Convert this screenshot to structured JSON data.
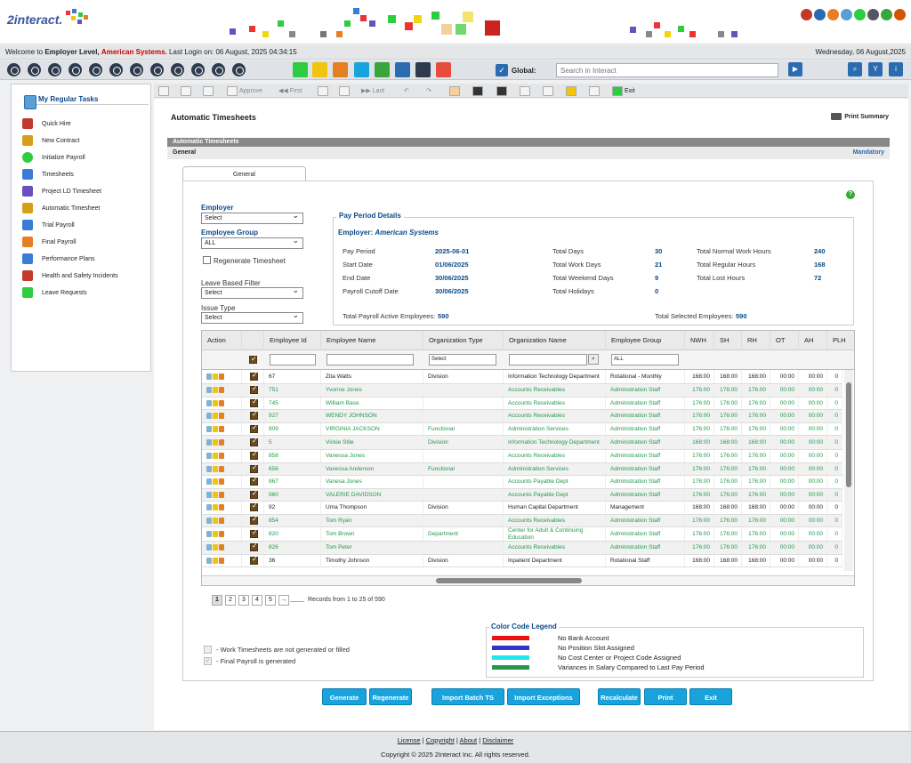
{
  "app": {
    "logo_text": "2interact."
  },
  "welcome": {
    "prefix": "Welcome to",
    "level": "Employer Level,",
    "company": "American Systems.",
    "login": "Last Login on: 06 August, 2025 04:34:15",
    "date": "Wednesday, 06 August,2025"
  },
  "global_search": {
    "label": "Global:",
    "placeholder": "Search in Interact"
  },
  "sidebar": {
    "title": "My Regular Tasks",
    "items": [
      {
        "label": "Quick Hire",
        "icon": "quick-hire-icon",
        "color": "#c0392b"
      },
      {
        "label": "New Contract",
        "icon": "new-contract-icon",
        "color": "#d4a017"
      },
      {
        "label": "Initialize Payroll",
        "icon": "initialize-payroll-icon",
        "color": "#2ecc40"
      },
      {
        "label": "Timesheets",
        "icon": "timesheets-icon",
        "color": "#3a7bd5"
      },
      {
        "label": "Project LD Timesheet",
        "icon": "project-timesheet-icon",
        "color": "#6b4fbb"
      },
      {
        "label": "Automatic Timesheet",
        "icon": "automatic-timesheet-icon",
        "color": "#d4a017"
      },
      {
        "label": "Trial Payroll",
        "icon": "trial-payroll-icon",
        "color": "#3a7bd5"
      },
      {
        "label": "Final Payroll",
        "icon": "final-payroll-icon",
        "color": "#e67e22"
      },
      {
        "label": "Performance Plans",
        "icon": "performance-plans-icon",
        "color": "#3a7bd5"
      },
      {
        "label": "Health and Safety Incidents",
        "icon": "health-safety-icon",
        "color": "#c0392b"
      },
      {
        "label": "Leave Requests",
        "icon": "leave-requests-icon",
        "color": "#2ecc40"
      }
    ]
  },
  "actionbar": {
    "approve": "Approve",
    "first": "First",
    "last": "Last",
    "exit": "Exit"
  },
  "page": {
    "title": "Automatic Timesheets",
    "print": "Print Summary",
    "section": "Automatic Timesheets",
    "subsection": "General",
    "mandatory": "Mandatory",
    "tab": "General"
  },
  "form": {
    "employer_label": "Employer",
    "employer_value": "Select",
    "group_label": "Employee Group",
    "group_value": "ALL",
    "regenerate_label": "Regenerate Timesheet",
    "leave_label": "Leave Based Filter",
    "leave_value": "Select",
    "issue_label": "Issue Type",
    "issue_value": "Select"
  },
  "pay_period": {
    "title": "Pay Period Details",
    "employer_label": "Employer:",
    "employer_name": "American Systems",
    "pay_period_label": "Pay Period",
    "pay_period": "2025-06-01",
    "start_label": "Start Date",
    "start": "01/06/2025",
    "end_label": "End Date",
    "end": "30/06/2025",
    "cutoff_label": "Payroll Cutoff Date",
    "cutoff": "30/06/2025",
    "total_days_label": "Total Days",
    "total_days": "30",
    "work_days_label": "Total Work Days",
    "work_days": "21",
    "weekend_label": "Total Weekend Days",
    "weekend": "9",
    "holidays_label": "Total Holidays",
    "holidays": "0",
    "normal_hours_label": "Total Normal Work Hours",
    "normal_hours": "240",
    "regular_hours_label": "Total Regular Hours",
    "regular_hours": "168",
    "lost_hours_label": "Total Lost Hours",
    "lost_hours": "72",
    "active_label": "Total Payroll Active Employees:",
    "active": "590",
    "selected_label": "Total Selected Employees:",
    "selected": "590"
  },
  "grid": {
    "columns": [
      "Action",
      "Employee Id",
      "Employee Name",
      "Organization Type",
      "Organization Name",
      "Employee Group",
      "NWH",
      "SH",
      "RH",
      "OT",
      "AH",
      "PLH"
    ],
    "filters": {
      "org_type": "Select",
      "group": "ALL"
    },
    "rows": [
      {
        "id": "67",
        "name": "Zita Watts",
        "otype": "Division",
        "oname": "Information Technology Department",
        "group": "Rotational - Monthly",
        "nwh": "168:00",
        "sh": "168:00",
        "rh": "168:00",
        "ot": "00:00",
        "ah": "00:00",
        "green": false
      },
      {
        "id": "751",
        "name": "Yvonne Jones",
        "otype": "",
        "oname": "Accounts Receivables",
        "group": "Administration Staff",
        "nwh": "176:00",
        "sh": "176:00",
        "rh": "176:00",
        "ot": "00:00",
        "ah": "00:00",
        "green": true
      },
      {
        "id": "745",
        "name": "William Base",
        "otype": "",
        "oname": "Accounts Receivables",
        "group": "Administration Staff",
        "nwh": "176:00",
        "sh": "176:00",
        "rh": "176:00",
        "ot": "00:00",
        "ah": "00:00",
        "green": true
      },
      {
        "id": "927",
        "name": "WENDY JOHNSON",
        "otype": "",
        "oname": "Accounts Receivables",
        "group": "Administration Staff",
        "nwh": "176:00",
        "sh": "176:00",
        "rh": "176:00",
        "ot": "00:00",
        "ah": "00:00",
        "green": true
      },
      {
        "id": "909",
        "name": "VIRGINIA JACKSON",
        "otype": "Functional",
        "oname": "Administration Services",
        "group": "Administration Staff",
        "nwh": "176:00",
        "sh": "176:00",
        "rh": "176:00",
        "ot": "00:00",
        "ah": "00:00",
        "green": true
      },
      {
        "id": "5",
        "name": "Vickie Stile",
        "otype": "Division",
        "oname": "Information Technology Department",
        "group": "Administration Staff",
        "nwh": "168:00",
        "sh": "168:00",
        "rh": "168:00",
        "ot": "00:00",
        "ah": "00:00",
        "green": true
      },
      {
        "id": "858",
        "name": "Vanessa Jones",
        "otype": "",
        "oname": "Accounts Receivables",
        "group": "Administration Staff",
        "nwh": "176:00",
        "sh": "176:00",
        "rh": "176:00",
        "ot": "00:00",
        "ah": "00:00",
        "green": true
      },
      {
        "id": "656",
        "name": "Vanessa Anderson",
        "otype": "Functional",
        "oname": "Administration Services",
        "group": "Administration Staff",
        "nwh": "176:00",
        "sh": "176:00",
        "rh": "176:00",
        "ot": "00:00",
        "ah": "00:00",
        "green": true
      },
      {
        "id": "867",
        "name": "Vanesa Jones",
        "otype": "",
        "oname": "Accounts Payable Dept",
        "group": "Administration Staff",
        "nwh": "176:00",
        "sh": "176:00",
        "rh": "176:00",
        "ot": "00:00",
        "ah": "00:00",
        "green": true
      },
      {
        "id": "960",
        "name": "VALERIE DAVIDSON",
        "otype": "",
        "oname": "Accounts Payable Dept",
        "group": "Administration Staff",
        "nwh": "176:00",
        "sh": "176:00",
        "rh": "176:00",
        "ot": "00:00",
        "ah": "00:00",
        "green": true
      },
      {
        "id": "92",
        "name": "Uma Thompson",
        "otype": "Division",
        "oname": "Human Capital Department",
        "group": "Management",
        "nwh": "168:00",
        "sh": "168:00",
        "rh": "168:00",
        "ot": "00:00",
        "ah": "00:00",
        "green": false
      },
      {
        "id": "854",
        "name": "Tom Ryan",
        "otype": "",
        "oname": "Accounts Receivables",
        "group": "Administration Staff",
        "nwh": "176:00",
        "sh": "176:00",
        "rh": "176:00",
        "ot": "00:00",
        "ah": "00:00",
        "green": true
      },
      {
        "id": "820",
        "name": "Tom Brown",
        "otype": "Department",
        "oname": "Center for Adult & Continuing Education",
        "group": "Administration Staff",
        "nwh": "176:00",
        "sh": "176:00",
        "rh": "176:00",
        "ot": "00:00",
        "ah": "00:00",
        "green": true
      },
      {
        "id": "826",
        "name": "Tom Peter",
        "otype": "",
        "oname": "Accounts Receivables",
        "group": "Administration Staff",
        "nwh": "176:00",
        "sh": "176:00",
        "rh": "176:00",
        "ot": "00:00",
        "ah": "00:00",
        "green": true
      },
      {
        "id": "36",
        "name": "Timothy Johnson",
        "otype": "Division",
        "oname": "Inpatient Department",
        "group": "Rotational Staff",
        "nwh": "168:00",
        "sh": "168:00",
        "rh": "168:00",
        "ot": "00:00",
        "ah": "00:00",
        "green": false
      }
    ],
    "pages": [
      "1",
      "2",
      "3",
      "4",
      "5",
      "→"
    ],
    "records": "Records from 1 to 25 of 590"
  },
  "legend": {
    "title": "Color Code Legend",
    "items": [
      {
        "label": "No Bank Account",
        "color": "#ee1111"
      },
      {
        "label": "No Position Slot Assigned",
        "color": "#3333cc"
      },
      {
        "label": "No Cost Center or Project Code Assigned",
        "color": "#22e5ee"
      },
      {
        "label": "Variances in Salary Compared to Last Pay Period",
        "color": "#22994a"
      }
    ]
  },
  "notes": [
    "- Work Timesheets are not generated or filled",
    "- Final Payroll is generated"
  ],
  "buttons": [
    "Generate",
    "Regenerate",
    "Import Batch TS",
    "Import Exceptions",
    "Recalculate",
    "Print",
    "Exit"
  ],
  "footer": {
    "links": [
      "License",
      "Copyright",
      "About",
      "Disclaimer"
    ],
    "copyright": "Copyright © 2025 2Interact Inc. All rights reserved."
  }
}
